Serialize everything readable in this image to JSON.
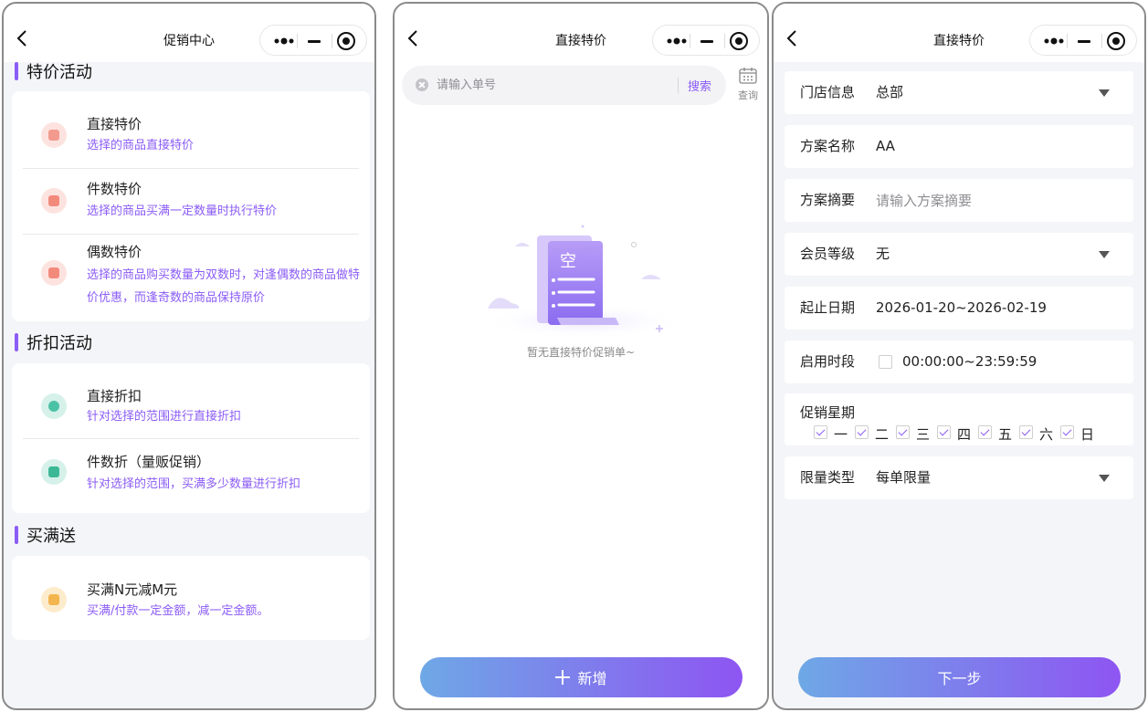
{
  "screen1": {
    "nav_title": "促销中心",
    "sections": [
      {
        "title": "特价活动",
        "items": [
          {
            "title": "直接特价",
            "desc": "选择的商品直接特价",
            "icon": "price-tag-icon"
          },
          {
            "title": "件数特价",
            "desc": "选择的商品买满一定数量时执行特价",
            "icon": "wallet-icon"
          },
          {
            "title": "偶数特价",
            "desc": "选择的商品购买数量为双数时，对逢偶数的商品做特价优惠，而逢奇数的商品保持原价",
            "icon": "card-icon"
          }
        ]
      },
      {
        "title": "折扣活动",
        "items": [
          {
            "title": "直接折扣",
            "desc": "针对选择的范围进行直接折扣",
            "icon": "share-icon"
          },
          {
            "title": "件数折（量贩促销）",
            "desc": "针对选择的范围，买满多少数量进行折扣",
            "icon": "bag-icon"
          }
        ]
      },
      {
        "title": "买满送",
        "items": [
          {
            "title": "买满N元减M元",
            "desc": "买满/付款一定金额，减一定金额。",
            "icon": "stamp-icon"
          }
        ]
      }
    ],
    "accent_color": "#8b5cf6"
  },
  "screen2": {
    "nav_title": "直接特价",
    "search_placeholder": "请输入单号",
    "search_button": "搜索",
    "query_label": "查询",
    "empty_glyph": "空",
    "empty_text": "暂无直接特价促销单~",
    "add_label": "新增"
  },
  "screen3": {
    "nav_title": "直接特价",
    "fields": {
      "store": {
        "label": "门店信息",
        "value": "总部"
      },
      "plan_name": {
        "label": "方案名称",
        "value": "AA"
      },
      "plan_summary": {
        "label": "方案摘要",
        "placeholder": "请输入方案摘要"
      },
      "member_level": {
        "label": "会员等级",
        "value": "无"
      },
      "date_range": {
        "label": "起止日期",
        "value": "2026-01-20~2026-02-19"
      },
      "time_range": {
        "label": "启用时段",
        "value": "00:00:00~23:59:59",
        "checked": false
      },
      "weekdays": {
        "label": "促销星期",
        "days": [
          "一",
          "二",
          "三",
          "四",
          "五",
          "六",
          "日"
        ],
        "all_checked": true
      },
      "limit_type": {
        "label": "限量类型",
        "value": "每单限量"
      }
    },
    "next_label": "下一步"
  },
  "colors": {
    "accent": "#8b5cf6",
    "gradient_start": "#6ea8e6",
    "gradient_end": "#8e55f2"
  }
}
